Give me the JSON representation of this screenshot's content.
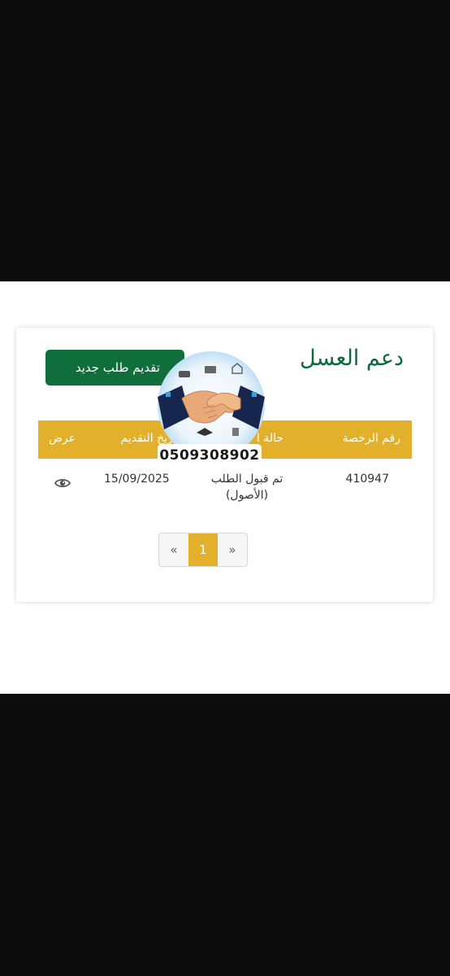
{
  "page": {
    "title": "دعم العسل",
    "new_request_label": "تقديم طلب جديد"
  },
  "table": {
    "headers": {
      "license": "رقم الرخصة",
      "status": "حالة ا",
      "date": "تاريخ التقديم",
      "view": "عرض"
    },
    "rows": [
      {
        "license": "410947",
        "status": "تم قبول الطلب (الأصول)",
        "date": "15/09/2025",
        "view_icon": "eye-icon"
      }
    ]
  },
  "pagination": {
    "prev": "«",
    "current": "1",
    "next": "»"
  },
  "overlay": {
    "phone": "0509308902"
  },
  "colors": {
    "brand_green": "#0f6e3b",
    "header_gold": "#e3b02c"
  }
}
